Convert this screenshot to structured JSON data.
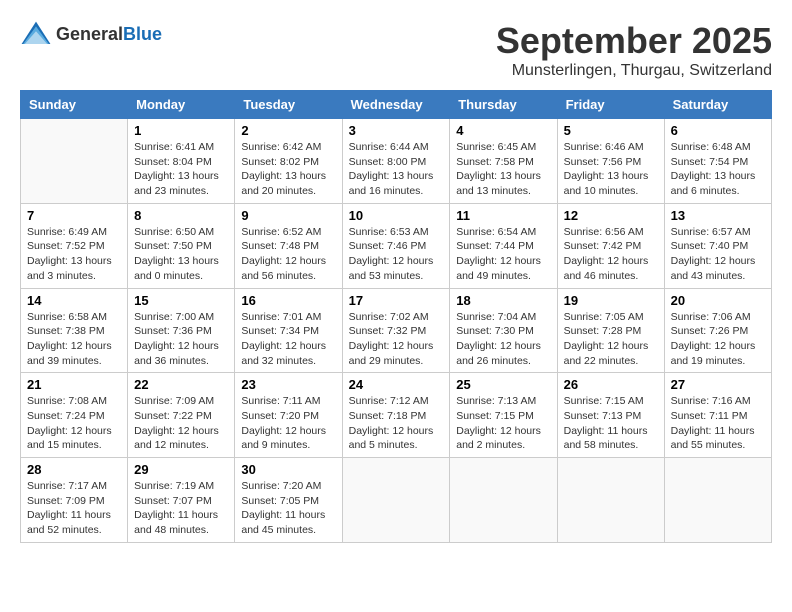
{
  "logo": {
    "general": "General",
    "blue": "Blue"
  },
  "title": "September 2025",
  "location": "Munsterlingen, Thurgau, Switzerland",
  "weekdays": [
    "Sunday",
    "Monday",
    "Tuesday",
    "Wednesday",
    "Thursday",
    "Friday",
    "Saturday"
  ],
  "weeks": [
    [
      {
        "day": "",
        "info": ""
      },
      {
        "day": "1",
        "info": "Sunrise: 6:41 AM\nSunset: 8:04 PM\nDaylight: 13 hours\nand 23 minutes."
      },
      {
        "day": "2",
        "info": "Sunrise: 6:42 AM\nSunset: 8:02 PM\nDaylight: 13 hours\nand 20 minutes."
      },
      {
        "day": "3",
        "info": "Sunrise: 6:44 AM\nSunset: 8:00 PM\nDaylight: 13 hours\nand 16 minutes."
      },
      {
        "day": "4",
        "info": "Sunrise: 6:45 AM\nSunset: 7:58 PM\nDaylight: 13 hours\nand 13 minutes."
      },
      {
        "day": "5",
        "info": "Sunrise: 6:46 AM\nSunset: 7:56 PM\nDaylight: 13 hours\nand 10 minutes."
      },
      {
        "day": "6",
        "info": "Sunrise: 6:48 AM\nSunset: 7:54 PM\nDaylight: 13 hours\nand 6 minutes."
      }
    ],
    [
      {
        "day": "7",
        "info": "Sunrise: 6:49 AM\nSunset: 7:52 PM\nDaylight: 13 hours\nand 3 minutes."
      },
      {
        "day": "8",
        "info": "Sunrise: 6:50 AM\nSunset: 7:50 PM\nDaylight: 13 hours\nand 0 minutes."
      },
      {
        "day": "9",
        "info": "Sunrise: 6:52 AM\nSunset: 7:48 PM\nDaylight: 12 hours\nand 56 minutes."
      },
      {
        "day": "10",
        "info": "Sunrise: 6:53 AM\nSunset: 7:46 PM\nDaylight: 12 hours\nand 53 minutes."
      },
      {
        "day": "11",
        "info": "Sunrise: 6:54 AM\nSunset: 7:44 PM\nDaylight: 12 hours\nand 49 minutes."
      },
      {
        "day": "12",
        "info": "Sunrise: 6:56 AM\nSunset: 7:42 PM\nDaylight: 12 hours\nand 46 minutes."
      },
      {
        "day": "13",
        "info": "Sunrise: 6:57 AM\nSunset: 7:40 PM\nDaylight: 12 hours\nand 43 minutes."
      }
    ],
    [
      {
        "day": "14",
        "info": "Sunrise: 6:58 AM\nSunset: 7:38 PM\nDaylight: 12 hours\nand 39 minutes."
      },
      {
        "day": "15",
        "info": "Sunrise: 7:00 AM\nSunset: 7:36 PM\nDaylight: 12 hours\nand 36 minutes."
      },
      {
        "day": "16",
        "info": "Sunrise: 7:01 AM\nSunset: 7:34 PM\nDaylight: 12 hours\nand 32 minutes."
      },
      {
        "day": "17",
        "info": "Sunrise: 7:02 AM\nSunset: 7:32 PM\nDaylight: 12 hours\nand 29 minutes."
      },
      {
        "day": "18",
        "info": "Sunrise: 7:04 AM\nSunset: 7:30 PM\nDaylight: 12 hours\nand 26 minutes."
      },
      {
        "day": "19",
        "info": "Sunrise: 7:05 AM\nSunset: 7:28 PM\nDaylight: 12 hours\nand 22 minutes."
      },
      {
        "day": "20",
        "info": "Sunrise: 7:06 AM\nSunset: 7:26 PM\nDaylight: 12 hours\nand 19 minutes."
      }
    ],
    [
      {
        "day": "21",
        "info": "Sunrise: 7:08 AM\nSunset: 7:24 PM\nDaylight: 12 hours\nand 15 minutes."
      },
      {
        "day": "22",
        "info": "Sunrise: 7:09 AM\nSunset: 7:22 PM\nDaylight: 12 hours\nand 12 minutes."
      },
      {
        "day": "23",
        "info": "Sunrise: 7:11 AM\nSunset: 7:20 PM\nDaylight: 12 hours\nand 9 minutes."
      },
      {
        "day": "24",
        "info": "Sunrise: 7:12 AM\nSunset: 7:18 PM\nDaylight: 12 hours\nand 5 minutes."
      },
      {
        "day": "25",
        "info": "Sunrise: 7:13 AM\nSunset: 7:15 PM\nDaylight: 12 hours\nand 2 minutes."
      },
      {
        "day": "26",
        "info": "Sunrise: 7:15 AM\nSunset: 7:13 PM\nDaylight: 11 hours\nand 58 minutes."
      },
      {
        "day": "27",
        "info": "Sunrise: 7:16 AM\nSunset: 7:11 PM\nDaylight: 11 hours\nand 55 minutes."
      }
    ],
    [
      {
        "day": "28",
        "info": "Sunrise: 7:17 AM\nSunset: 7:09 PM\nDaylight: 11 hours\nand 52 minutes."
      },
      {
        "day": "29",
        "info": "Sunrise: 7:19 AM\nSunset: 7:07 PM\nDaylight: 11 hours\nand 48 minutes."
      },
      {
        "day": "30",
        "info": "Sunrise: 7:20 AM\nSunset: 7:05 PM\nDaylight: 11 hours\nand 45 minutes."
      },
      {
        "day": "",
        "info": ""
      },
      {
        "day": "",
        "info": ""
      },
      {
        "day": "",
        "info": ""
      },
      {
        "day": "",
        "info": ""
      }
    ]
  ]
}
